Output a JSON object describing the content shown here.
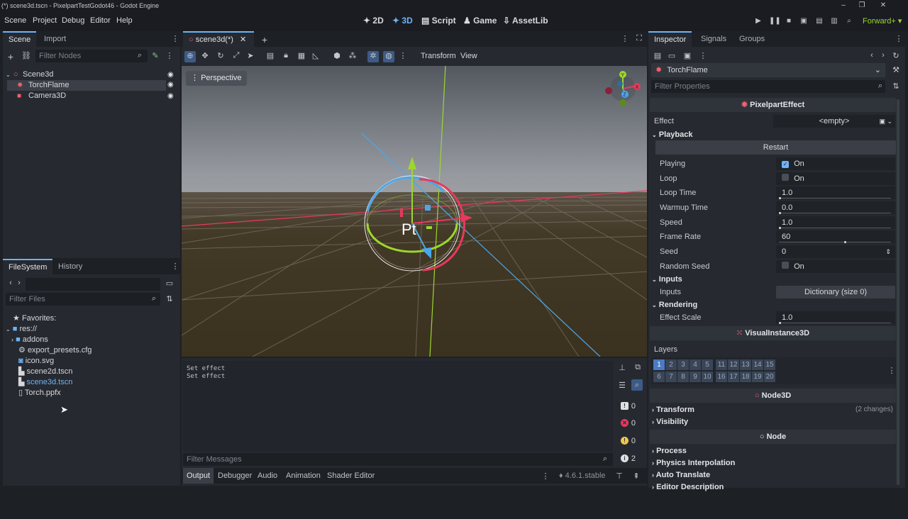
{
  "window": {
    "title": "(*) scene3d.tscn - PixelpartTestGodot46 - Godot Engine"
  },
  "menu": [
    "Scene",
    "Project",
    "Debug",
    "Editor",
    "Help"
  ],
  "workspaces": {
    "w2d": "2D",
    "w3d": "3D",
    "script": "Script",
    "game": "Game",
    "assetlib": "AssetLib"
  },
  "renderer": "Forward+",
  "scene_dock": {
    "tabs": [
      "Scene",
      "Import"
    ],
    "filter_placeholder": "Filter Nodes",
    "nodes": [
      {
        "name": "Scene3d"
      },
      {
        "name": "TorchFlame"
      },
      {
        "name": "Camera3D"
      }
    ]
  },
  "filesystem": {
    "tabs": [
      "FileSystem",
      "History"
    ],
    "filter_placeholder": "Filter Files",
    "favorites": "Favorites:",
    "root": "res://",
    "items": [
      "addons",
      "export_presets.cfg",
      "icon.svg",
      "scene2d.tscn",
      "scene3d.tscn",
      "Torch.ppfx"
    ]
  },
  "editor": {
    "scene_tab": "scene3d(*)",
    "toolbar_transform": "Transform",
    "toolbar_view": "View",
    "perspective_label": "Perspective",
    "gizmo_label": "Pt"
  },
  "output": {
    "lines": [
      "Set effect",
      "Set effect"
    ],
    "filter_placeholder": "Filter Messages",
    "counts": {
      "log": "0",
      "error": "0",
      "warning": "0",
      "info": "2"
    },
    "tabs": [
      "Output",
      "Debugger",
      "Audio",
      "Animation",
      "Shader Editor"
    ],
    "version": "4.6.1.stable"
  },
  "inspector": {
    "tabs": [
      "Inspector",
      "Signals",
      "Groups"
    ],
    "node_name": "TorchFlame",
    "filter_placeholder": "Filter Properties",
    "class_header": "PixelpartEffect",
    "effect_label": "Effect",
    "effect_value": "<empty>",
    "playback": {
      "title": "Playback",
      "restart": "Restart",
      "playing_label": "Playing",
      "playing_val": "On",
      "loop_label": "Loop",
      "loop_val": "On",
      "loop_time_label": "Loop Time",
      "loop_time_val": "1.0",
      "warmup_label": "Warmup Time",
      "warmup_val": "0.0",
      "speed_label": "Speed",
      "speed_val": "1.0",
      "frame_rate_label": "Frame Rate",
      "frame_rate_val": "60",
      "seed_label": "Seed",
      "seed_val": "0",
      "random_seed_label": "Random Seed",
      "random_seed_val": "On"
    },
    "inputs": {
      "title": "Inputs",
      "label": "Inputs",
      "value": "Dictionary (size 0)"
    },
    "rendering": {
      "title": "Rendering",
      "label": "Effect Scale",
      "value": "1.0"
    },
    "visual_header": "VisualInstance3D",
    "layers_label": "Layers",
    "layers": [
      "1",
      "2",
      "3",
      "4",
      "5",
      "11",
      "12",
      "13",
      "14",
      "15",
      "6",
      "7",
      "8",
      "9",
      "10",
      "16",
      "17",
      "18",
      "19",
      "20"
    ],
    "node3d_header": "Node3D",
    "transform_label": "Transform",
    "transform_changes": "(2 changes)",
    "visibility_label": "Visibility",
    "node_header": "Node",
    "process_label": "Process",
    "physics_label": "Physics Interpolation",
    "auto_translate_label": "Auto Translate",
    "editor_desc_label": "Editor Description"
  },
  "colors": {
    "accent": "#6eb3f7",
    "x_axis": "#e8395d",
    "y_axis": "#9bd82d",
    "z_axis": "#4aa7ea"
  }
}
